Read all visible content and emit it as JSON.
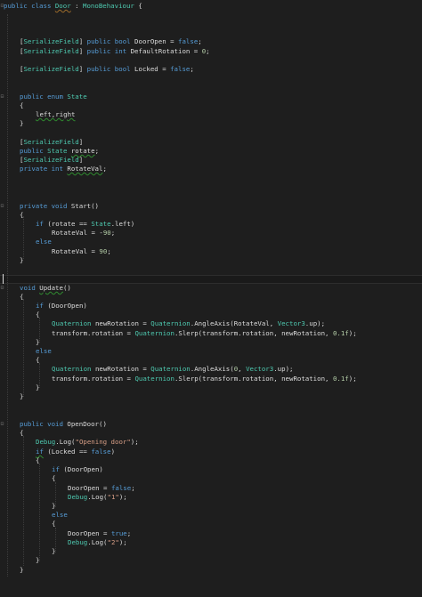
{
  "editor": {
    "code": {
      "L1a": "public class ",
      "L1b": "Door",
      "L1c": " : ",
      "L1d": "MonoBehaviour",
      "L1e": " {",
      "L3a": "[",
      "L3b": "SerializeField",
      "L3c": "] ",
      "L3d": "public bool",
      "L3e": " DoorOpen = ",
      "L3f": "false",
      "L3g": ";",
      "L4a": "[",
      "L4b": "SerializeField",
      "L4c": "] ",
      "L4d": "public int",
      "L4e": " DefaultRotation = ",
      "L4f": "0",
      "L4g": ";",
      "L5a": "[",
      "L5b": "SerializeField",
      "L5c": "] ",
      "L5d": "public bool",
      "L5e": " Locked = ",
      "L5f": "false",
      "L5g": ";",
      "L7a": "public enum ",
      "L7b": "State",
      "L8": "{",
      "L9": "left,right",
      "L10": "}",
      "L12a": "[",
      "L12b": "SerializeField",
      "L12c": "]",
      "L13a": "public ",
      "L13b": "State",
      "L13c": " ",
      "L13d": "rotate",
      "L13e": ";",
      "L14a": "[",
      "L14b": "SerializeField",
      "L14c": "]",
      "L15a": "private int ",
      "L15b": "RotateVal",
      "L15c": ";",
      "L17a": "private void ",
      "L17b": "Start()",
      "L18": "{",
      "L19a": "if",
      "L19b": " (rotate == ",
      "L19c": "State",
      "L19d": ".left)",
      "L20a": "RotateVal = -",
      "L20b": "90",
      "L20c": ";",
      "L21": "else",
      "L22a": "RotateVal = ",
      "L22b": "90",
      "L22c": ";",
      "L23": "}",
      "L25a": "void ",
      "L25b": "Update",
      "L25c": "()",
      "L26": "{",
      "L27a": "if",
      "L27b": " (DoorOpen)",
      "L28": "{",
      "L29a": "Quaternion",
      "L29b": " newRotation = ",
      "L29c": "Quaternion",
      "L29d": ".AngleAxis(RotateVal, ",
      "L29e": "Vector3",
      "L29f": ".up);",
      "L30a": "transform.rotation = ",
      "L30b": "Quaternion",
      "L30c": ".Slerp(transform.rotation, newRotation, ",
      "L30d": "0.1f",
      "L30e": ");",
      "L31": "}",
      "L32": "else",
      "L33": "{",
      "L34a": "Quaternion",
      "L34b": " newRotation = ",
      "L34c": "Quaternion",
      "L34d": ".AngleAxis(",
      "L34e": "0",
      "L34f": ", ",
      "L34g": "Vector3",
      "L34h": ".up);",
      "L35a": "transform.rotation = ",
      "L35b": "Quaternion",
      "L35c": ".Slerp(transform.rotation, newRotation, ",
      "L35d": "0.1f",
      "L35e": ");",
      "L36": "}",
      "L37": "}",
      "L39a": "public void ",
      "L39b": "OpenDoor()",
      "L40": "{",
      "L41a": "Debug",
      "L41b": ".Log(",
      "L41c": "\"Opening door\"",
      "L41d": ");",
      "L42a": "if",
      "L42b": " (Locked == ",
      "L42c": "false",
      "L42d": ")",
      "L43": "{",
      "L44a": "if",
      "L44b": " (DoorOpen)",
      "L45": "{",
      "L46a": "DoorOpen = ",
      "L46b": "false",
      "L46c": ";",
      "L47a": "Debug",
      "L47b": ".Log(",
      "L47c": "\"1\"",
      "L47d": ");",
      "L48": "}",
      "L49": "else",
      "L50": "{",
      "L51a": "DoorOpen = ",
      "L51b": "true",
      "L51c": ";",
      "L52a": "Debug",
      "L52b": ".Log(",
      "L52c": "\"2\"",
      "L52d": ");",
      "L53": "}",
      "L54": "}",
      "L55": "}"
    },
    "fold_glyph": "⊟",
    "colors": {
      "background": "#1e1e1e",
      "keyword": "#569cd6",
      "type": "#4ec9b0",
      "string": "#d69d85",
      "number": "#b5cea8",
      "text": "#dcdcdc"
    }
  }
}
